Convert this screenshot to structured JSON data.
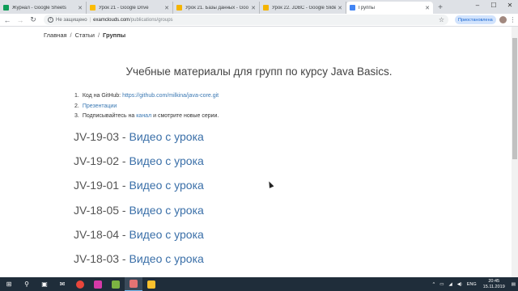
{
  "browser": {
    "tabs": [
      {
        "title": "Журнал - Google Sheets",
        "color": "#0f9d58",
        "active": false
      },
      {
        "title": "Урок 21 - Google Drive",
        "color": "#fbbc04",
        "active": false
      },
      {
        "title": "Урок 21. Базы данных - Goo",
        "color": "#f4b400",
        "active": false
      },
      {
        "title": "Урок 22. JDBC - Google Slides",
        "color": "#f4b400",
        "active": false
      },
      {
        "title": "Группы",
        "color": "#4285f4",
        "active": true
      }
    ],
    "new_tab_glyph": "+",
    "window_controls": [
      "–",
      "☐",
      "✕"
    ],
    "address": {
      "security_label": "Не защищено",
      "host": "examclouds.com",
      "path": "/publications/groups"
    },
    "paused_label": "Приостановлена",
    "menu_glyph": "⋮"
  },
  "breadcrumb": {
    "home": "Главная",
    "articles": "Статьи",
    "current": "Группы"
  },
  "page": {
    "title": "Учебные материалы для групп по курсу Java Basics.",
    "links": [
      {
        "num": "1.",
        "prefix": "Код на GitHub: ",
        "link": "https://github.com/milkina/java-core.git",
        "suffix": ""
      },
      {
        "num": "2.",
        "prefix": "",
        "link": "Презентации",
        "suffix": ""
      },
      {
        "num": "3.",
        "prefix": "Подписывайтесь на ",
        "link": "канал",
        "suffix": " и смотрите новые серии."
      }
    ],
    "lessons": [
      {
        "code": "JV-19-03 - ",
        "link": "Видео с урока"
      },
      {
        "code": "JV-19-02 - ",
        "link": "Видео с урока"
      },
      {
        "code": "JV-19-01 - ",
        "link": "Видео с урока"
      },
      {
        "code": "JV-18-05 - ",
        "link": "Видео с урока"
      },
      {
        "code": "JV-18-04 - ",
        "link": "Видео с урока"
      },
      {
        "code": "JV-18-03 - ",
        "link": "Видео с урока"
      }
    ]
  },
  "taskbar": {
    "apps": [
      {
        "name": "windows-start-icon",
        "color": "#ffffff"
      },
      {
        "name": "search-icon",
        "color": "#ffffff"
      },
      {
        "name": "task-view-icon",
        "color": "#ffffff"
      },
      {
        "name": "mail-icon",
        "color": "#ffffff"
      },
      {
        "name": "chrome-icon",
        "color": "#e9463b"
      },
      {
        "name": "intellij-icon",
        "color": "#d63aa8"
      },
      {
        "name": "game-icon",
        "color": "#7cb342"
      },
      {
        "name": "screen-recorder-icon",
        "color": "#e57373"
      },
      {
        "name": "folder-icon",
        "color": "#fbc02d"
      }
    ],
    "language": "ENG",
    "time": "20:45",
    "date": "15.11.2019"
  }
}
